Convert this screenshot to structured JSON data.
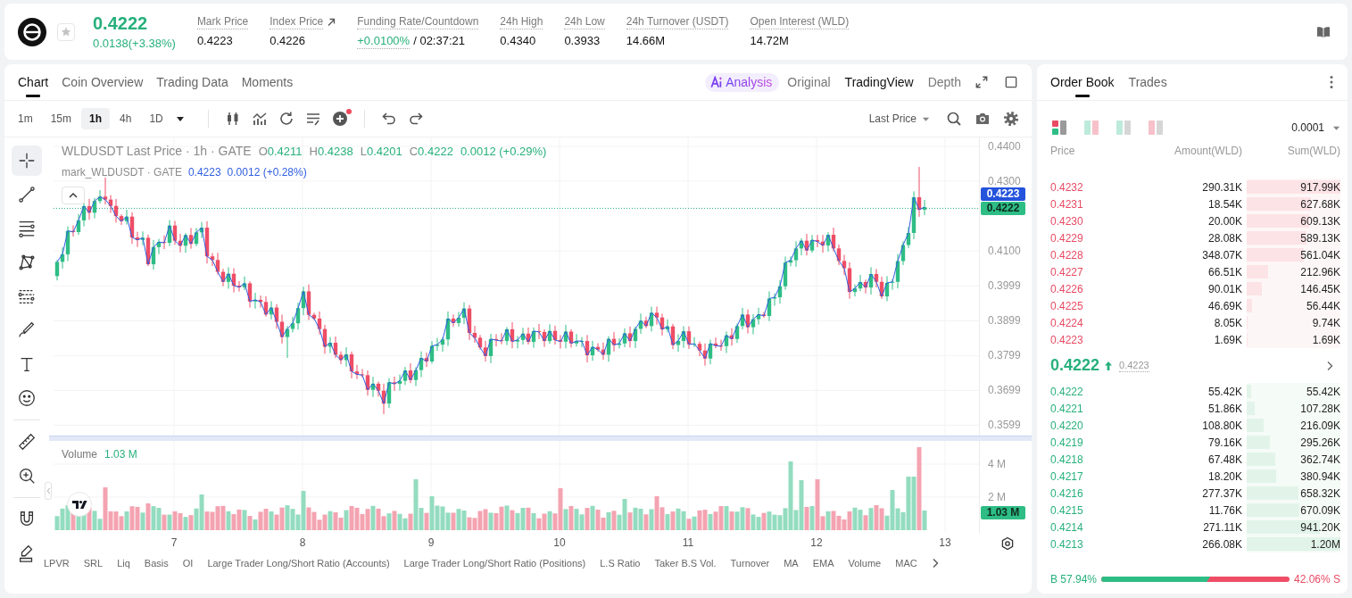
{
  "header": {
    "price": "0.4222",
    "change": "0.0138(+3.38%)",
    "starred": false,
    "stats": [
      {
        "kind": "plain",
        "label": "Mark Price",
        "value": "0.4223"
      },
      {
        "kind": "link",
        "label": "Index Price",
        "value": "0.4226"
      },
      {
        "kind": "funding",
        "label": "Funding Rate/Countdown",
        "value": "+0.0100%",
        "countdown": "/ 02:37:21"
      },
      {
        "kind": "plain",
        "label": "24h High",
        "value": "0.4340"
      },
      {
        "kind": "plain",
        "label": "24h Low",
        "value": "0.3933"
      },
      {
        "kind": "plain",
        "label": "24h Turnover (USDT)",
        "value": "14.66M"
      },
      {
        "kind": "plain",
        "label": "Open Interest (WLD)",
        "value": "14.72M"
      }
    ]
  },
  "chart_panel": {
    "tabs": [
      {
        "label": "Chart",
        "selected": true
      },
      {
        "label": "Coin Overview",
        "selected": false
      },
      {
        "label": "Trading Data",
        "selected": false
      },
      {
        "label": "Moments",
        "selected": false
      }
    ],
    "views": [
      {
        "kind": "ai",
        "label": "Analysis",
        "selected": false
      },
      {
        "kind": "view",
        "label": "Original",
        "selected": false
      },
      {
        "kind": "view",
        "label": "TradingView",
        "selected": true
      },
      {
        "kind": "view",
        "label": "Depth",
        "selected": false
      }
    ]
  },
  "toolbar": {
    "intervals": [
      {
        "label": "1m",
        "selected": false
      },
      {
        "label": "15m",
        "selected": false
      },
      {
        "label": "1h",
        "selected": true
      },
      {
        "label": "4h",
        "selected": false
      },
      {
        "label": "1D",
        "selected": false
      }
    ],
    "indicator_alert": true,
    "price_source": "Last Price"
  },
  "drawing_tools": [
    {
      "tools": [
        {
          "kind": "crosshair",
          "selected": true
        },
        {
          "kind": "trend_line",
          "selected": false
        },
        {
          "kind": "parallel_channel",
          "selected": false
        },
        {
          "kind": "pattern",
          "selected": false
        },
        {
          "kind": "fib",
          "selected": false
        },
        {
          "kind": "brush",
          "selected": false
        },
        {
          "kind": "text",
          "selected": false
        },
        {
          "kind": "emoji",
          "selected": false
        }
      ]
    },
    {
      "tools": [
        {
          "kind": "ruler",
          "selected": false
        },
        {
          "kind": "zoom",
          "selected": false
        }
      ]
    },
    {
      "tools": [
        {
          "kind": "magnet",
          "selected": false
        },
        {
          "kind": "pencil",
          "selected": false
        }
      ]
    }
  ],
  "legend": {
    "title": "WLDUSDT Last Price · 1h · GATE",
    "ohlc": [
      {
        "key": "O",
        "value": "0.4211"
      },
      {
        "key": "H",
        "value": "0.4238"
      },
      {
        "key": "L",
        "value": "0.4201"
      },
      {
        "key": "C",
        "value": "0.4222"
      }
    ],
    "change": "0.0012 (+0.29%)",
    "mark_title": "mark_WLDUSDT · GATE",
    "mark_price": "0.4223",
    "mark_change": "0.0012 (+0.28%)"
  },
  "price_axis": {
    "ticks": [
      "0.4400",
      "0.4300",
      "0.4100",
      "0.3999",
      "0.3899",
      "0.3799",
      "0.3699",
      "0.3599"
    ],
    "mark_label": "0.4223",
    "last_label": "0.4222"
  },
  "volume": {
    "title": "Volume",
    "value": "1.03 M",
    "ticks": [
      "4 M",
      "2 M"
    ],
    "last_label": "1.03 M"
  },
  "time_axis": [
    "7",
    "8",
    "9",
    "10",
    "11",
    "12",
    "13"
  ],
  "indicators": [
    "LPVR",
    "SRL",
    "Liq",
    "Basis",
    "OI",
    "Large Trader Long/Short Ratio (Accounts)",
    "Large Trader Long/Short Ratio (Positions)",
    "L.S Ratio",
    "Taker B.S Vol.",
    "Turnover",
    "MA",
    "EMA",
    "Volume",
    "MAC"
  ],
  "order_book": {
    "tabs": [
      {
        "label": "Order Book",
        "selected": true
      },
      {
        "label": "Trades",
        "selected": false
      }
    ],
    "layouts": [
      {
        "kind": "both",
        "selected": true
      },
      {
        "kind": "split",
        "selected": false
      },
      {
        "kind": "bids",
        "selected": false
      },
      {
        "kind": "asks",
        "selected": false
      }
    ],
    "precision": "0.0001",
    "columns": [
      "Price",
      "Amount(WLD)",
      "Sum(WLD)"
    ],
    "asks": [
      {
        "price": "0.4232",
        "amount": "290.31K",
        "sum": "917.99K",
        "level": 1.0
      },
      {
        "price": "0.4231",
        "amount": "18.54K",
        "sum": "627.68K",
        "level": 0.684
      },
      {
        "price": "0.4230",
        "amount": "20.00K",
        "sum": "609.13K",
        "level": 0.664
      },
      {
        "price": "0.4229",
        "amount": "28.08K",
        "sum": "589.13K",
        "level": 0.642
      },
      {
        "price": "0.4228",
        "amount": "348.07K",
        "sum": "561.04K",
        "level": 0.611
      },
      {
        "price": "0.4227",
        "amount": "66.51K",
        "sum": "212.96K",
        "level": 0.232
      },
      {
        "price": "0.4226",
        "amount": "90.01K",
        "sum": "146.45K",
        "level": 0.16
      },
      {
        "price": "0.4225",
        "amount": "46.69K",
        "sum": "56.44K",
        "level": 0.061
      },
      {
        "price": "0.4224",
        "amount": "8.05K",
        "sum": "9.74K",
        "level": 0.011
      },
      {
        "price": "0.4223",
        "amount": "1.69K",
        "sum": "1.69K",
        "level": 0.002
      }
    ],
    "mid": {
      "price": "0.4222",
      "up": true,
      "mark": "0.4223"
    },
    "bids": [
      {
        "price": "0.4222",
        "amount": "55.42K",
        "sum": "55.42K",
        "level": 0.046
      },
      {
        "price": "0.4221",
        "amount": "51.86K",
        "sum": "107.28K",
        "level": 0.089
      },
      {
        "price": "0.4220",
        "amount": "108.80K",
        "sum": "216.09K",
        "level": 0.18
      },
      {
        "price": "0.4219",
        "amount": "79.16K",
        "sum": "295.26K",
        "level": 0.246
      },
      {
        "price": "0.4218",
        "amount": "67.48K",
        "sum": "362.74K",
        "level": 0.302
      },
      {
        "price": "0.4217",
        "amount": "18.20K",
        "sum": "380.94K",
        "level": 0.317
      },
      {
        "price": "0.4216",
        "amount": "277.37K",
        "sum": "658.32K",
        "level": 0.549
      },
      {
        "price": "0.4215",
        "amount": "11.76K",
        "sum": "670.09K",
        "level": 0.558
      },
      {
        "price": "0.4214",
        "amount": "271.11K",
        "sum": "941.20K",
        "level": 0.784
      },
      {
        "price": "0.4213",
        "amount": "266.08K",
        "sum": "1.20M",
        "level": 1.0
      }
    ],
    "ratio": {
      "buy": "B 57.94%",
      "sell": "42.06% S",
      "level": 0.5794
    }
  }
}
